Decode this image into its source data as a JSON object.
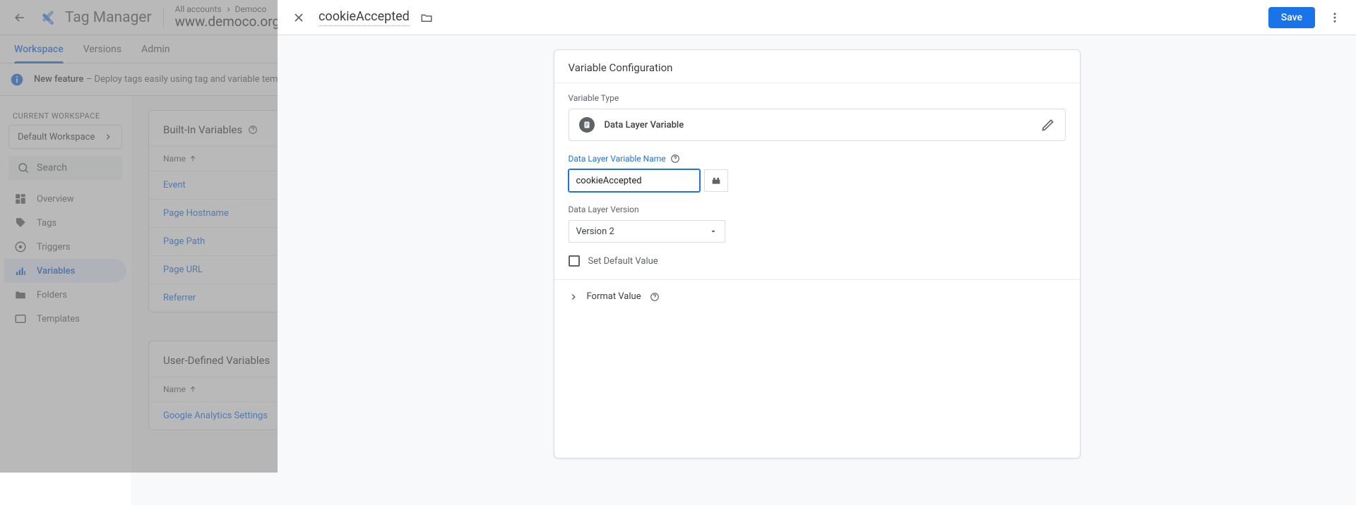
{
  "app": {
    "product": "Tag Manager",
    "breadcrumb_root": "All accounts",
    "breadcrumb_account": "Democo",
    "container": "www.democo.org"
  },
  "tabs": {
    "workspace": "Workspace",
    "versions": "Versions",
    "admin": "Admin"
  },
  "banner": {
    "lead": "New feature",
    "text": "–  Deploy tags easily using tag and variable templates from the community gallery."
  },
  "sidebar": {
    "section_label": "CURRENT WORKSPACE",
    "workspace": "Default Workspace",
    "search_placeholder": "Search",
    "items": {
      "overview": "Overview",
      "tags": "Tags",
      "triggers": "Triggers",
      "variables": "Variables",
      "folders": "Folders",
      "templates": "Templates"
    }
  },
  "builtins": {
    "title": "Built-In Variables",
    "col": "Name",
    "rows": [
      "Event",
      "Page Hostname",
      "Page Path",
      "Page URL",
      "Referrer"
    ]
  },
  "userdef": {
    "title": "User-Defined Variables",
    "col": "Name",
    "rows": [
      "Google Analytics Settings"
    ]
  },
  "overlay": {
    "title": "cookieAccepted",
    "save": "Save",
    "card_title": "Variable Configuration",
    "type_label": "Variable Type",
    "type_value": "Data Layer Variable",
    "name_label": "Data Layer Variable Name",
    "name_value": "cookieAccepted",
    "version_label": "Data Layer Version",
    "version_value": "Version 2",
    "set_default": "Set Default Value",
    "format": "Format Value"
  }
}
